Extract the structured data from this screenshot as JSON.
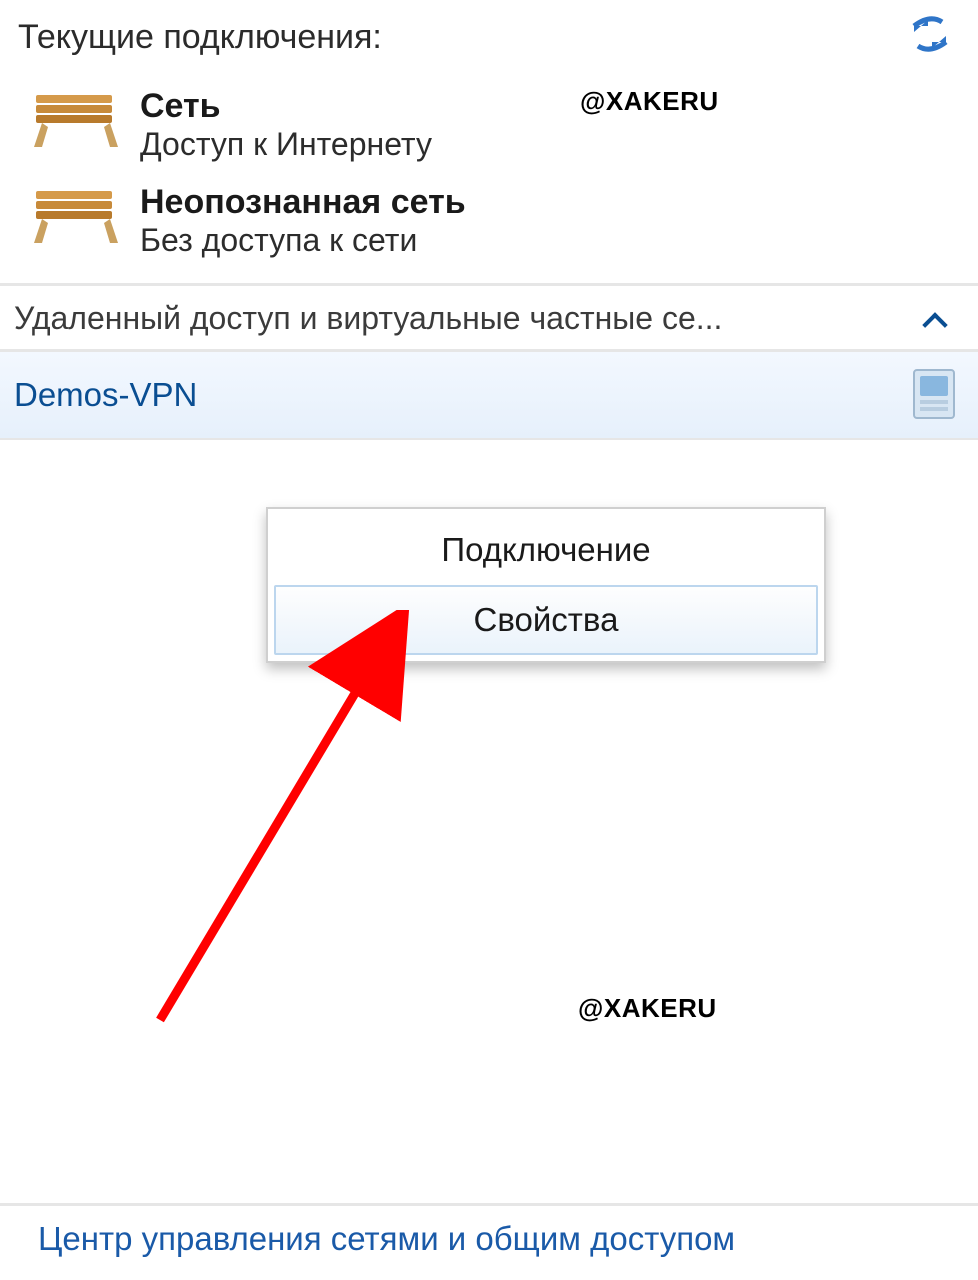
{
  "header": {
    "title": "Текущие подключения:"
  },
  "connections": [
    {
      "name": "Сеть",
      "status": "Доступ к Интернету"
    },
    {
      "name": "Неопознанная сеть",
      "status": "Без доступа к сети"
    }
  ],
  "section": {
    "title": "Удаленный доступ и виртуальные частные се..."
  },
  "vpn": {
    "name": "Demos-VPN"
  },
  "context_menu": {
    "items": [
      {
        "label": "Подключение",
        "hover": false
      },
      {
        "label": "Свойства",
        "hover": true
      }
    ]
  },
  "footer": {
    "link": "Центр управления сетями и общим доступом"
  },
  "watermark": "@XAKERU",
  "colors": {
    "link": "#1a5aa8",
    "accent": "#0a4e92",
    "arrow": "#ff0000"
  }
}
